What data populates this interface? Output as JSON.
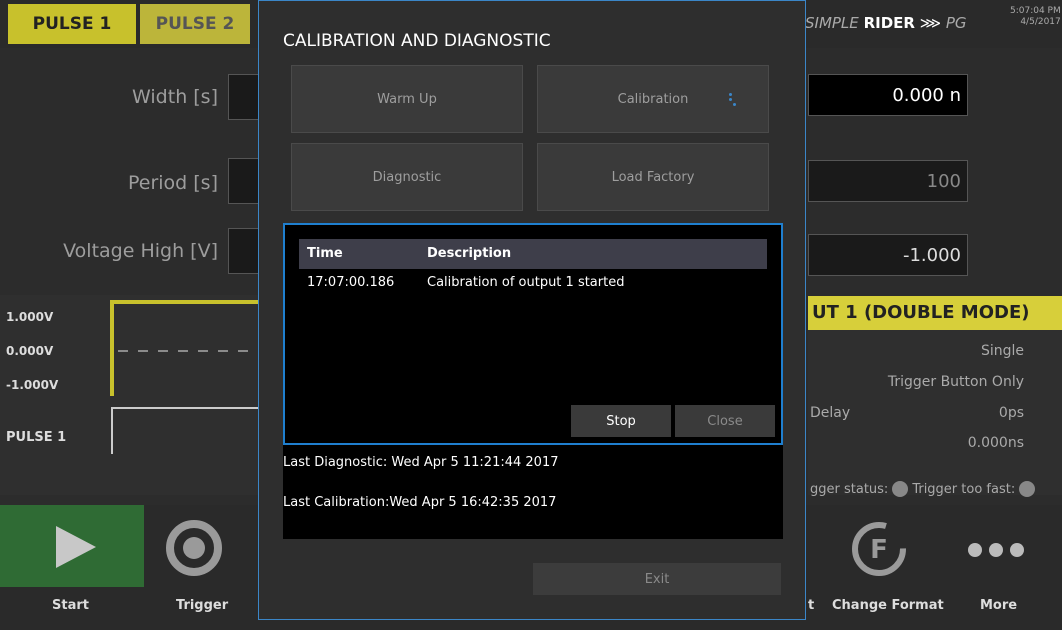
{
  "app": {
    "tabs": [
      "PULSE 1",
      "PULSE 2"
    ],
    "brand": {
      "prefix": "SIMPLE",
      "name": "RIDER",
      "suffix": "PG"
    },
    "clock": {
      "time": "5:07:04 PM",
      "date": "4/5/2017"
    },
    "fields": [
      {
        "label": "Width [s]",
        "value": "0.000 n"
      },
      {
        "label": "Period [s]",
        "value": "100"
      },
      {
        "label": "Voltage High [V]",
        "value": "-1.000"
      }
    ],
    "wave": {
      "levels": [
        "1.000V",
        "0.000V",
        "-1.000V"
      ],
      "channel": "PULSE 1"
    },
    "output_header": "UT 1 (DOUBLE MODE)",
    "output_rows": [
      {
        "label": "",
        "value": "Single"
      },
      {
        "label": "",
        "value": "Trigger Button Only"
      },
      {
        "label": "Delay",
        "value": "0ps"
      },
      {
        "label": "",
        "value": "0.000ns"
      }
    ],
    "status": {
      "trigger_status": "gger status:",
      "trigger_fast": "Trigger too fast:"
    },
    "bottom": {
      "start": "Start",
      "trigger": "Trigger",
      "t": "t",
      "change_format": "Change Format",
      "more": "More"
    }
  },
  "modal": {
    "title": "CALIBRATION AND DIAGNOSTIC",
    "buttons": {
      "warm_up": "Warm Up",
      "calibration": "Calibration",
      "diagnostic": "Diagnostic",
      "load_factory": "Load Factory"
    },
    "log": {
      "headers": {
        "time": "Time",
        "description": "Description"
      },
      "rows": [
        {
          "time": "17:07:00.186",
          "description": "Calibration of output 1 started"
        }
      ],
      "stop": "Stop",
      "close": "Close"
    },
    "last_diagnostic": "Last Diagnostic: Wed Apr  5 11:21:44 2017",
    "last_calibration": "Last Calibration:Wed Apr  5 16:42:35 2017",
    "exit": "Exit"
  },
  "colors": {
    "accent": "#1f7fcf",
    "yellow": "#c8c12c",
    "start_green": "#2f6b34"
  }
}
